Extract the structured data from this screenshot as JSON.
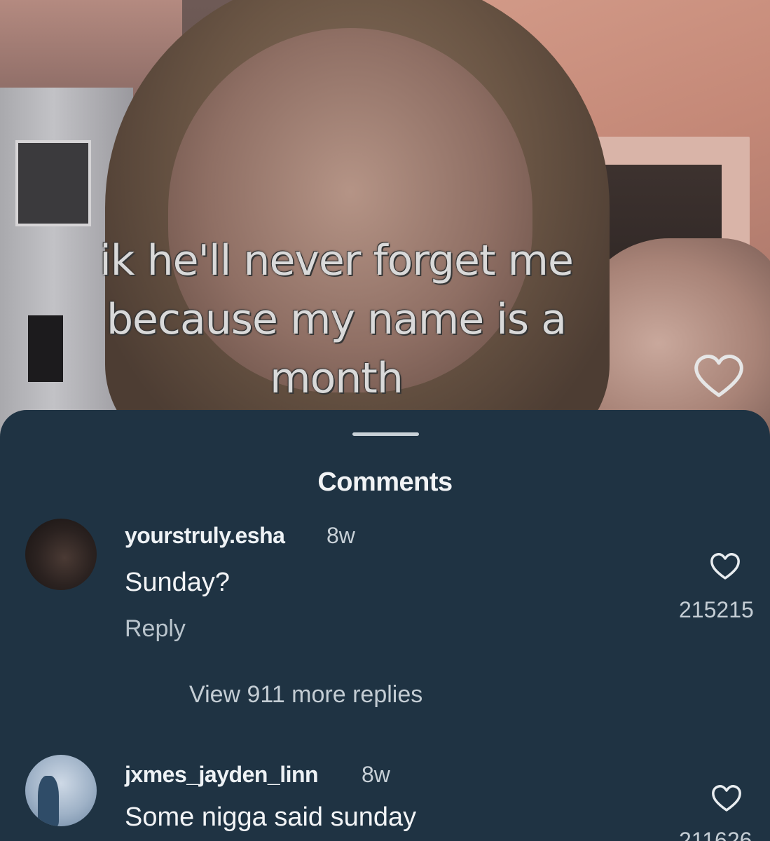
{
  "video": {
    "caption_lines": [
      "ik he'll never forget me",
      "because my name is a",
      "month"
    ]
  },
  "comments_sheet": {
    "title": "Comments",
    "comments": [
      {
        "username": "yourstruly.esha",
        "time": "8w",
        "text": "Sunday?",
        "reply_label": "Reply",
        "like_count": "215215",
        "view_replies": "View 911 more replies"
      },
      {
        "username": "jxmes_jayden_linn",
        "time": "8w",
        "text": "Some nigga said sunday",
        "like_count": "211626"
      }
    ]
  },
  "icons": {
    "video_like": "heart-outline-icon",
    "comment_like": "heart-outline-icon"
  },
  "colors": {
    "sheet_background": "#1f3343",
    "primary_text": "#f1f3f5",
    "secondary_text": "#c4cdd4"
  }
}
